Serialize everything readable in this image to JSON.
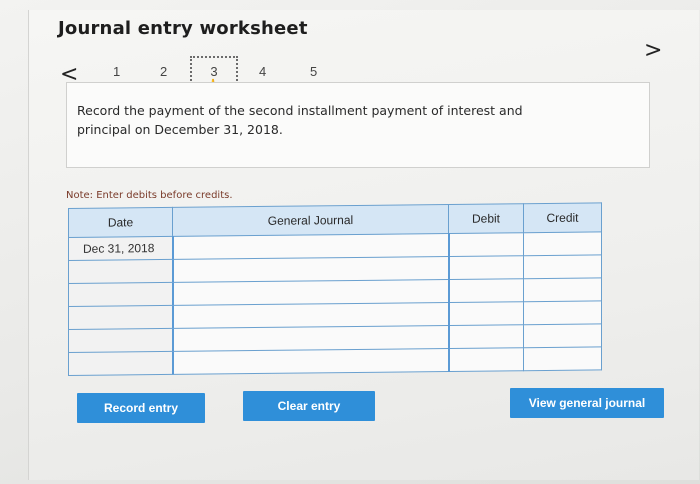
{
  "header": {
    "title": "Journal entry worksheet"
  },
  "nav": {
    "prev_icon": "<",
    "next_icon": ">",
    "steps": [
      "1",
      "2",
      "3",
      "4",
      "5"
    ],
    "active_step": "3"
  },
  "prompt": {
    "text": "Record the payment of the second installment payment of interest and principal on December 31, 2018."
  },
  "note": "Note: Enter debits before credits.",
  "table": {
    "columns": [
      "Date",
      "General Journal",
      "Debit",
      "Credit"
    ],
    "rows": [
      {
        "date": "Dec 31, 2018",
        "account": "",
        "debit": "",
        "credit": ""
      },
      {
        "date": "",
        "account": "",
        "debit": "",
        "credit": ""
      },
      {
        "date": "",
        "account": "",
        "debit": "",
        "credit": ""
      },
      {
        "date": "",
        "account": "",
        "debit": "",
        "credit": ""
      },
      {
        "date": "",
        "account": "",
        "debit": "",
        "credit": ""
      },
      {
        "date": "",
        "account": "",
        "debit": "",
        "credit": ""
      }
    ]
  },
  "buttons": {
    "record": "Record entry",
    "clear": "Clear entry",
    "view": "View general journal"
  },
  "colors": {
    "accent": "#2f8fd9",
    "header_fill": "#d5e6f5",
    "grid_line": "#6aa0cf"
  }
}
